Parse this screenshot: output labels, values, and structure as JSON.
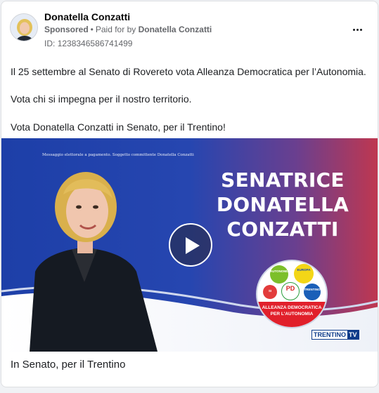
{
  "header": {
    "page_name": "Donatella Conzatti",
    "sponsored_label": "Sponsored",
    "separator": "•",
    "paid_for_prefix": "Paid for by",
    "paid_for_name": "Donatella Conzatti",
    "id_label": "ID:",
    "id_value": "1238346586741499",
    "more_icon": "more-horizontal-icon"
  },
  "body": {
    "line1": "Il 25 settembre al Senato di Rovereto vota Alleanza Democratica per l’Autonomia.",
    "line2": "Vota chi si impegna per il nostro territorio.",
    "line3": "Vota Donatella Conzatti in Senato, per il Trentino!"
  },
  "media": {
    "disclaimer": "Messaggio elettorale a pagamento. Soggetto committente Donatella Conzatti",
    "headline_1": "SENATRICE",
    "headline_2": "DONATELLA",
    "headline_3": "CONZATTI",
    "play_icon": "play-icon",
    "alliance_line1": "ALLEANZA DEMOCRATICA",
    "alliance_line2": "PER L'AUTONOMIA",
    "brand_a": "TRENTINO",
    "brand_b": "TV",
    "party_autonomia": "AUTONOMIA",
    "party_europa": "EUROPA",
    "party_sinistra": "SI",
    "party_pd": "PD",
    "party_trentino": "TRENTINO",
    "colors": {
      "blue": "#1c3b9e",
      "red": "#c0374f",
      "alliance_red": "#e1202b"
    }
  },
  "caption": "In Senato, per il Trentino"
}
